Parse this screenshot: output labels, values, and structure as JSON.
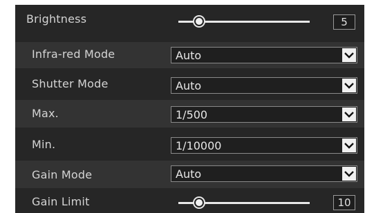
{
  "brightness": {
    "label": "Brightness",
    "value": "5",
    "level": 0.13
  },
  "infrared": {
    "label": "Infra-red Mode",
    "value": "Auto"
  },
  "shutter": {
    "label": "Shutter Mode",
    "value": "Auto"
  },
  "max": {
    "label": "Max.",
    "value": "1/500"
  },
  "min": {
    "label": "Min.",
    "value": "1/10000"
  },
  "gain_mode": {
    "label": "Gain Mode",
    "value": "Auto"
  },
  "gain_limit": {
    "label": "Gain Limit",
    "value": "10",
    "level": 0.13
  },
  "icons": {
    "dropdown": "chevron-down-icon"
  }
}
